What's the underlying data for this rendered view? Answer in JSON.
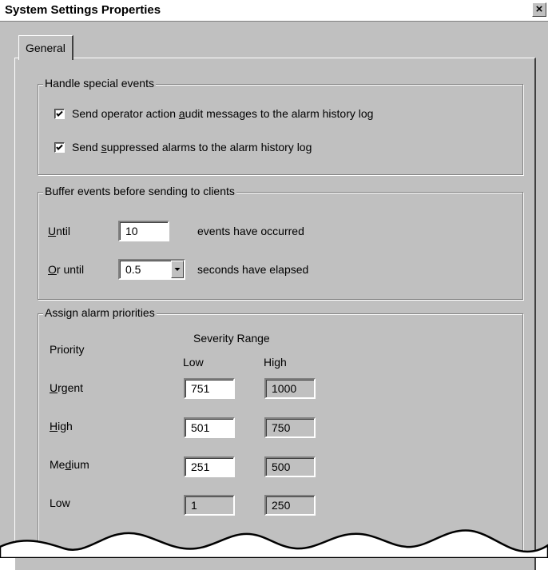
{
  "window": {
    "title": "System Settings Properties",
    "close_label": "×"
  },
  "tab": {
    "label": "General"
  },
  "special_events": {
    "legend": "Handle special events",
    "audit": {
      "checked": true,
      "pre": "Send operator action ",
      "ul": "a",
      "post": "udit messages to the alarm history log"
    },
    "suppressed": {
      "checked": true,
      "pre": "Send ",
      "ul": "s",
      "post": "uppressed alarms to the alarm history log"
    }
  },
  "buffer": {
    "legend": "Buffer events before sending to clients",
    "until": {
      "label_ul": "U",
      "label_rest": "ntil",
      "value": "10",
      "suffix": "events have occurred"
    },
    "or_until": {
      "label_ul": "O",
      "label_rest": "r until",
      "value": "0.5",
      "suffix": "seconds have elapsed"
    }
  },
  "priorities": {
    "legend": "Assign alarm priorities",
    "header_priority": "Priority",
    "header_range": "Severity Range",
    "header_low": "Low",
    "header_high": "High",
    "rows": [
      {
        "pre": "",
        "ul": "U",
        "post": "rgent",
        "low": "751",
        "high": "1000"
      },
      {
        "pre": "",
        "ul": "H",
        "post": "igh",
        "low": "501",
        "high": "750"
      },
      {
        "pre": "Me",
        "ul": "d",
        "post": "ium",
        "low": "251",
        "high": "500"
      },
      {
        "pre": "Low",
        "ul": "",
        "post": "",
        "low": "1",
        "high": "250"
      }
    ]
  }
}
